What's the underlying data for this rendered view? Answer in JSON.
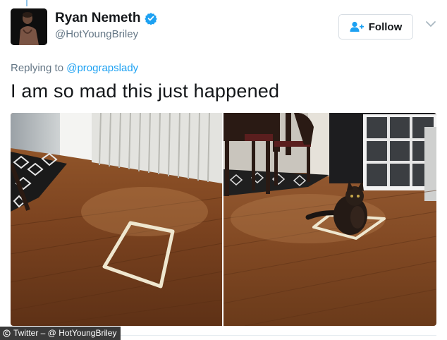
{
  "user": {
    "name": "Ryan Nemeth",
    "handle": "@HotYoungBriley",
    "verified": true
  },
  "follow_button": {
    "label": "Follow",
    "icon": "add-user-icon"
  },
  "reply": {
    "prefix": "Replying to",
    "mention": "@prograpslady"
  },
  "tweet": {
    "text": "I am so mad this just happened"
  },
  "media": [
    {
      "name": "photo-tape-square-floor"
    },
    {
      "name": "photo-cat-in-tape-square"
    }
  ],
  "credit": {
    "text": "Twitter – @ HotYoungBriley"
  },
  "colors": {
    "accent": "#1da1f2",
    "secondary_text": "#657786",
    "verified_badge": "#1da1f2"
  }
}
